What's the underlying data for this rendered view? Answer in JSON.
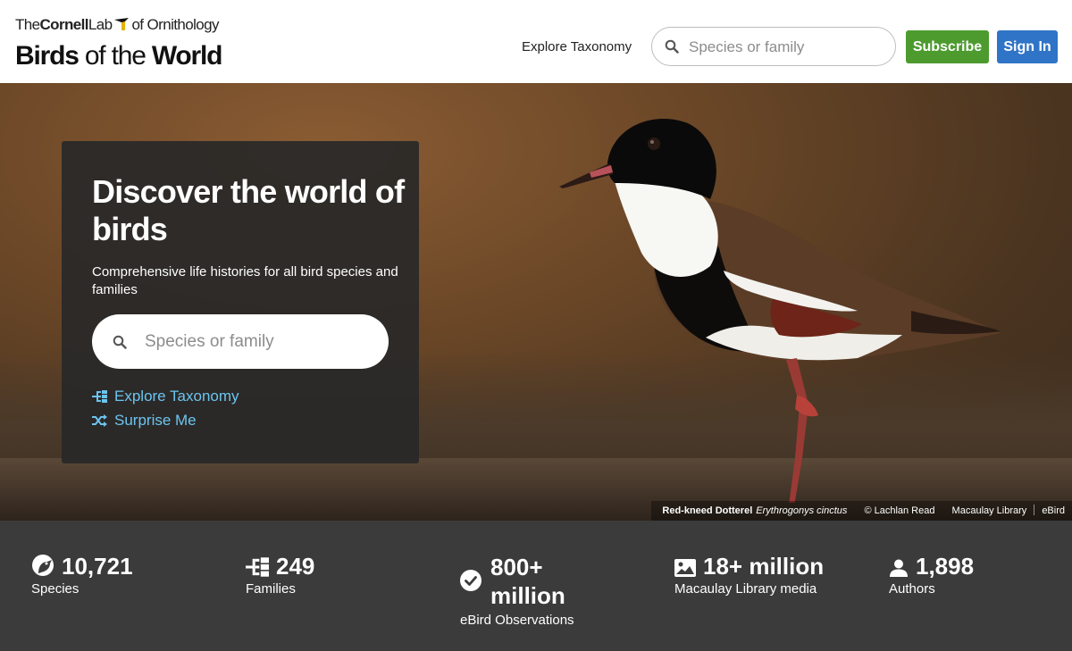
{
  "header": {
    "logo_lab_prefix": "The",
    "logo_lab_name": "Cornell",
    "logo_lab_suffix": "Lab",
    "logo_lab_ornithology": "of Ornithology",
    "logo_birds": "Birds",
    "logo_of_the": " of the ",
    "logo_world": "World",
    "nav_explore_taxonomy": "Explore Taxonomy",
    "search_placeholder": "Species or family",
    "subscribe_label": "Subscribe",
    "signin_label": "Sign In",
    "colors": {
      "subscribe": "#4d9b2f",
      "signin": "#2f74c6"
    }
  },
  "hero": {
    "title": "Discover the world of birds",
    "subtitle": "Comprehensive life histories for all bird species and families",
    "search_placeholder": "Species or family",
    "explore_taxonomy": "Explore Taxonomy",
    "surprise_me": "Surprise Me",
    "link_color": "#6cc4ef",
    "photo_credit": {
      "common_name": "Red-kneed Dotterel",
      "scientific_name": "Erythrogonys cinctus",
      "photographer": "© Lachlan Read",
      "library": "Macaulay Library",
      "source": "eBird"
    }
  },
  "stats": [
    {
      "icon": "bird-head-icon",
      "value": "10,721",
      "label": "Species"
    },
    {
      "icon": "taxonomy-tree-icon",
      "value": "249",
      "label": "Families"
    },
    {
      "icon": "check-circle-icon",
      "value": "800+ million",
      "label": "eBird Observations"
    },
    {
      "icon": "image-icon",
      "value": "18+ million",
      "label": "Macaulay Library media"
    },
    {
      "icon": "person-icon",
      "value": "1,898",
      "label": "Authors"
    }
  ]
}
